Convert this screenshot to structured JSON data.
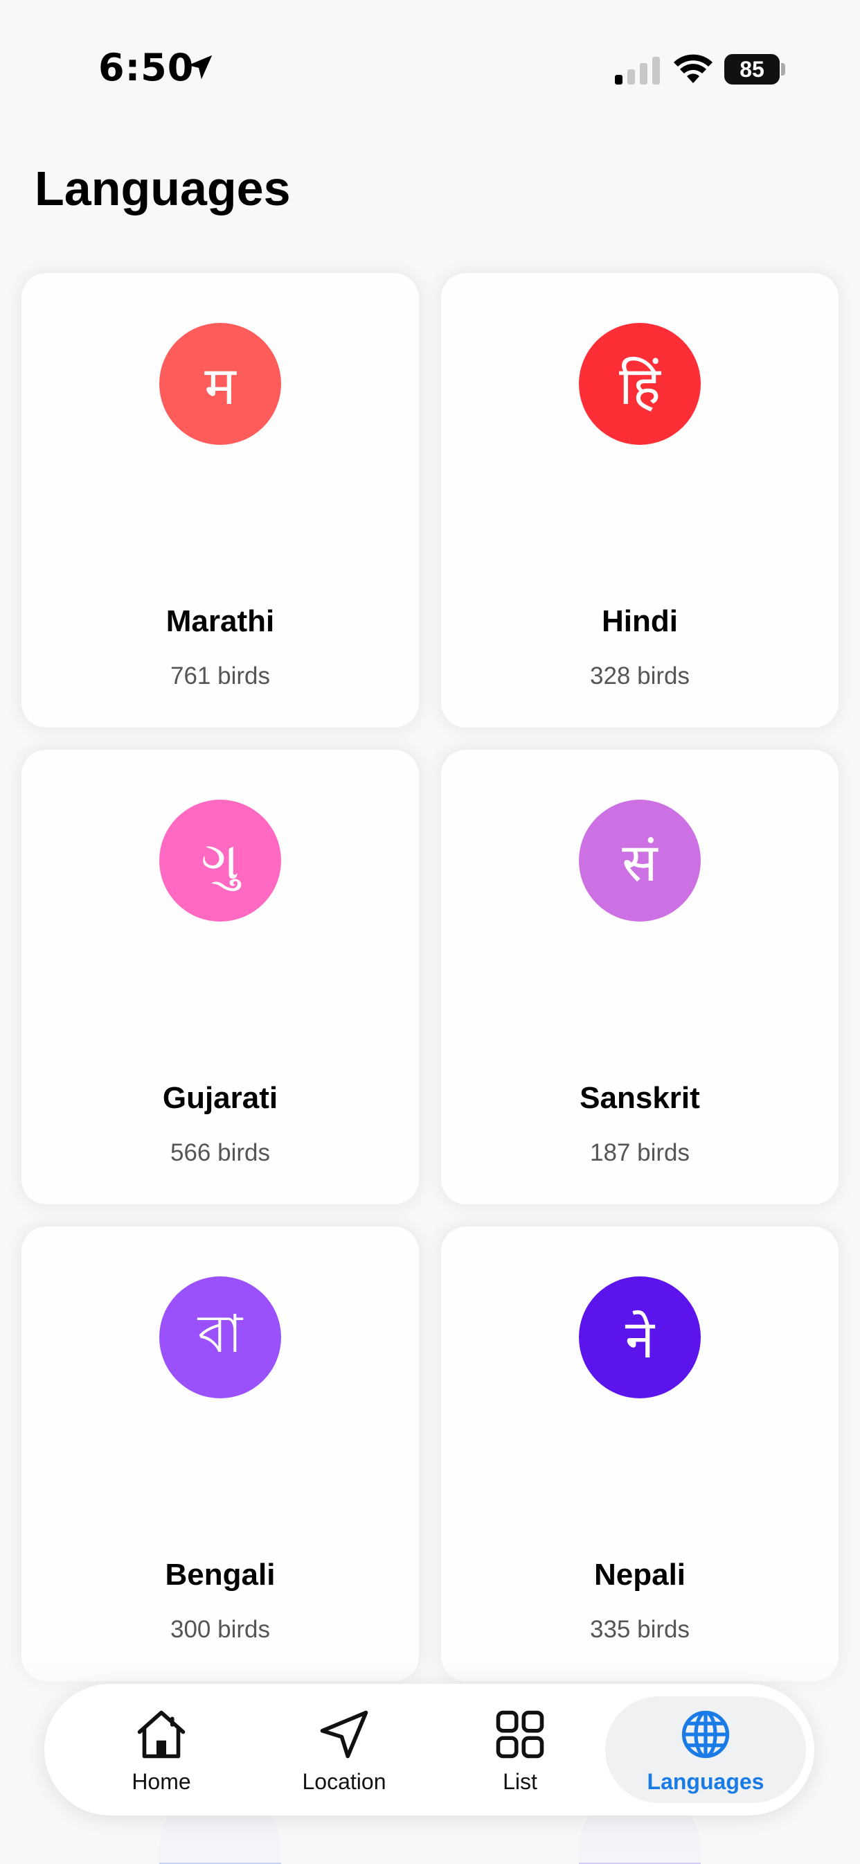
{
  "status_bar": {
    "time": "6:50",
    "battery": "85",
    "icons": [
      "location-arrow-icon",
      "cellular-signal-icon",
      "wifi-icon",
      "battery-icon"
    ]
  },
  "page": {
    "title": "Languages"
  },
  "languages": [
    {
      "glyph": "म",
      "name": "Marathi",
      "count": "761 birds",
      "color": "#fd5c5a"
    },
    {
      "glyph": "हिं",
      "name": "Hindi",
      "count": "328 birds",
      "color": "#fe2e36"
    },
    {
      "glyph": "ગુ",
      "name": "Gujarati",
      "count": "566 birds",
      "color": "#ff69c1"
    },
    {
      "glyph": "सं",
      "name": "Sanskrit",
      "count": "187 birds",
      "color": "#cc70e4"
    },
    {
      "glyph": "বা",
      "name": "Bengali",
      "count": "300 birds",
      "color": "#9a51fc"
    },
    {
      "glyph": "ने",
      "name": "Nepali",
      "count": "335 birds",
      "color": "#5b14ec"
    }
  ],
  "tabbar": {
    "items": [
      {
        "label": "Home",
        "icon": "house-icon",
        "active": false
      },
      {
        "label": "Location",
        "icon": "navigation-arrow-icon",
        "active": false
      },
      {
        "label": "List",
        "icon": "grid-icon",
        "active": false
      },
      {
        "label": "Languages",
        "icon": "globe-icon",
        "active": true
      }
    ],
    "accent": "#1a7be6"
  }
}
